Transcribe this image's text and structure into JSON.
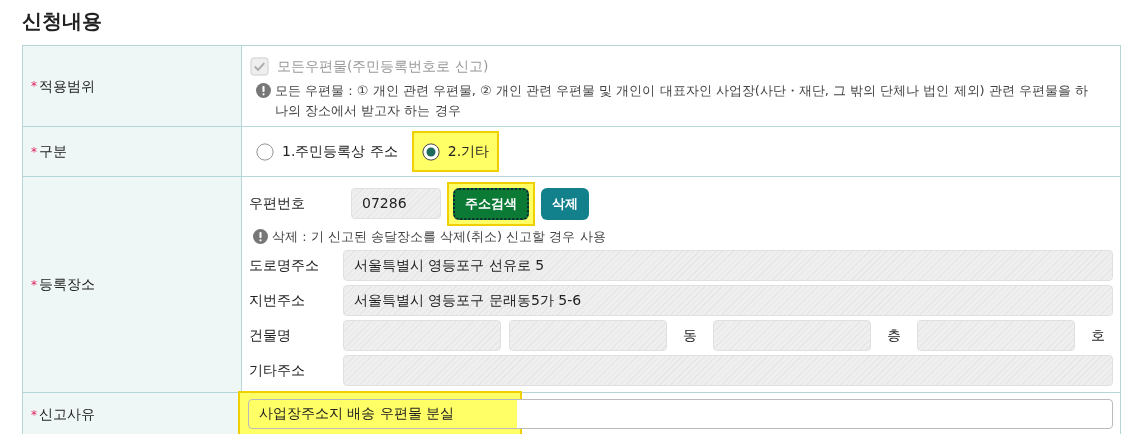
{
  "heading": "신청내용",
  "rows": [
    {
      "kind": "scope",
      "label": "적용범위",
      "required": "*",
      "checkbox": {
        "label": "모든우편물(주민등록번호로 신고)",
        "checked": true,
        "disabled": true
      },
      "note": "모든 우편물 : ① 개인 관련 우편물, ② 개인 관련 우편물 및 개인이 대표자인 사업장(사단・재단, 그 밖의 단체나 법인 제외) 관련 우편물을 하나의 장소에서 받고자 하는 경우"
    },
    {
      "kind": "radio",
      "label": "구분",
      "required": "*",
      "options": [
        {
          "label": "1.주민등록상 주소",
          "selected": false,
          "highlighted": false
        },
        {
          "label": "2.기타",
          "selected": true,
          "highlighted": true
        }
      ]
    },
    {
      "kind": "address",
      "label": "등록장소",
      "required": "*",
      "zip": {
        "label": "우편번호",
        "value": "07286"
      },
      "search_button": {
        "label": "주소검색",
        "highlighted": true
      },
      "delete_button": {
        "label": "삭제"
      },
      "note": "삭제 : 기 신고된 송달장소를 삭제(취소) 신고할 경우 사용",
      "road": {
        "label": "도로명주소",
        "value": "서울특별시 영등포구 선유로 5"
      },
      "lot": {
        "label": "지번주소",
        "value": "서울특별시 영등포구 문래동5가 5-6"
      },
      "building": {
        "label": "건물명",
        "fields": [
          {
            "kind": "plain"
          },
          {
            "kind": "unit",
            "suffix": "동"
          },
          {
            "kind": "unit",
            "suffix": "층"
          },
          {
            "kind": "unit",
            "suffix": "호"
          }
        ]
      },
      "other": {
        "label": "기타주소"
      }
    },
    {
      "kind": "text",
      "label": "신고사유",
      "required": "*",
      "value": "사업장주소지 배송 우편물 분실",
      "highlighted": true
    }
  ]
}
